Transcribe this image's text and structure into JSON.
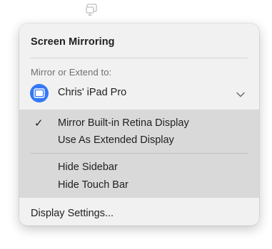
{
  "menubar": {
    "icon": "screen-mirroring-icon"
  },
  "panel": {
    "title": "Screen Mirroring",
    "section_label": "Mirror or Extend to:",
    "device": {
      "name": "Chris' iPad Pro",
      "icon": "ipad-icon",
      "accent_color": "#3478f6"
    },
    "options": [
      {
        "label": "Mirror Built-in Retina Display",
        "checked": "✓"
      },
      {
        "label": "Use As Extended Display",
        "checked": ""
      }
    ],
    "extra_options": [
      {
        "label": "Hide Sidebar"
      },
      {
        "label": "Hide Touch Bar"
      }
    ],
    "settings_label": "Display Settings..."
  }
}
